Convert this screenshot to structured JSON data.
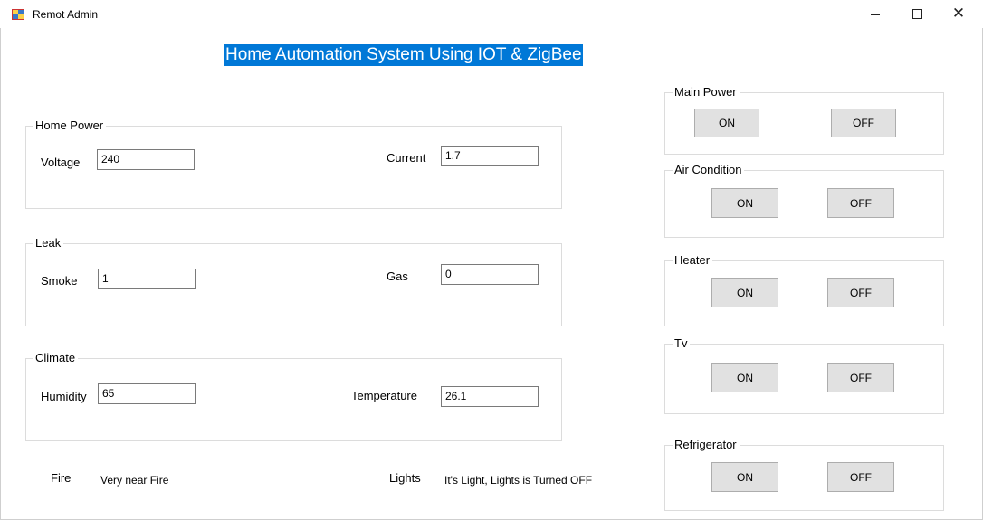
{
  "window": {
    "title": "Remot Admin",
    "minimize": "",
    "maximize": "",
    "close": "✕"
  },
  "heading": "Home Automation System Using IOT & ZigBee",
  "home_power": {
    "title": "Home Power",
    "voltage_label": "Voltage",
    "voltage_value": "240",
    "current_label": "Current",
    "current_value": "1.7"
  },
  "leak": {
    "title": "Leak",
    "smoke_label": "Smoke",
    "smoke_value": "1",
    "gas_label": "Gas",
    "gas_value": "0"
  },
  "climate": {
    "title": "Climate",
    "humidity_label": "Humidity",
    "humidity_value": "65",
    "temperature_label": "Temperature",
    "temperature_value": "26.1"
  },
  "fire": {
    "label": "Fire",
    "status": "Very near Fire"
  },
  "lights": {
    "label": "Lights",
    "status": "It's Light, Lights is Turned OFF"
  },
  "controls": {
    "main_power": {
      "title": "Main Power",
      "on": "ON",
      "off": "OFF"
    },
    "air_condition": {
      "title": "Air Condition",
      "on": "ON",
      "off": "OFF"
    },
    "heater": {
      "title": "Heater",
      "on": "ON",
      "off": "OFF"
    },
    "tv": {
      "title": "Tv",
      "on": "ON",
      "off": "OFF"
    },
    "refrigerator": {
      "title": "Refrigerator",
      "on": "ON",
      "off": "OFF"
    }
  },
  "colors": {
    "heading_bg": "#0078d7",
    "heading_fg": "#ffffff",
    "button_bg": "#e1e1e1",
    "group_border": "#dcdcdc"
  },
  "icons": {
    "app": "app-window-icon"
  }
}
